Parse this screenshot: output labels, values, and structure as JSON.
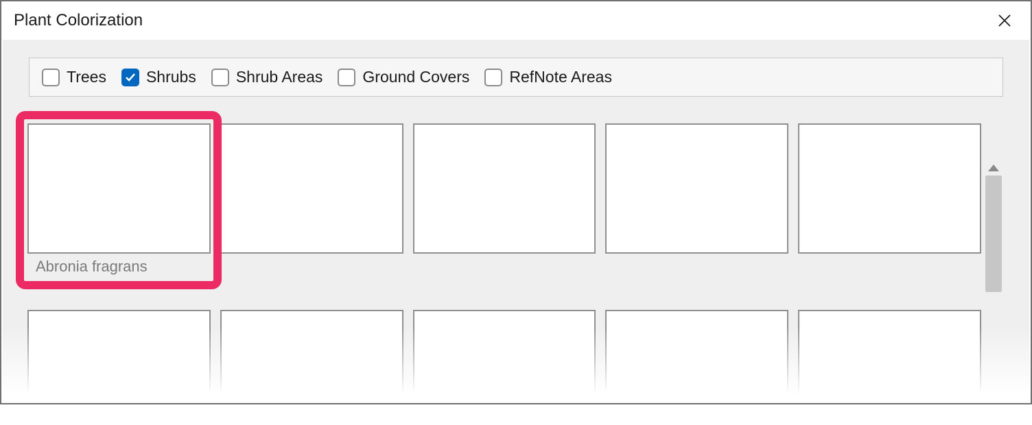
{
  "dialog": {
    "title": "Plant Colorization"
  },
  "filters": [
    {
      "label": "Trees",
      "checked": false
    },
    {
      "label": "Shrubs",
      "checked": true
    },
    {
      "label": "Shrub Areas",
      "checked": false
    },
    {
      "label": "Ground Covers",
      "checked": false
    },
    {
      "label": "RefNote Areas",
      "checked": false
    }
  ],
  "cards_row1": [
    {
      "label": "Abronia fragrans"
    },
    {
      "label": ""
    },
    {
      "label": ""
    },
    {
      "label": ""
    },
    {
      "label": ""
    }
  ],
  "cards_row2": [
    {
      "label": ""
    },
    {
      "label": ""
    },
    {
      "label": ""
    },
    {
      "label": ""
    },
    {
      "label": ""
    }
  ],
  "colors": {
    "accent": "#0067c0",
    "highlight": "#ec2a63"
  }
}
